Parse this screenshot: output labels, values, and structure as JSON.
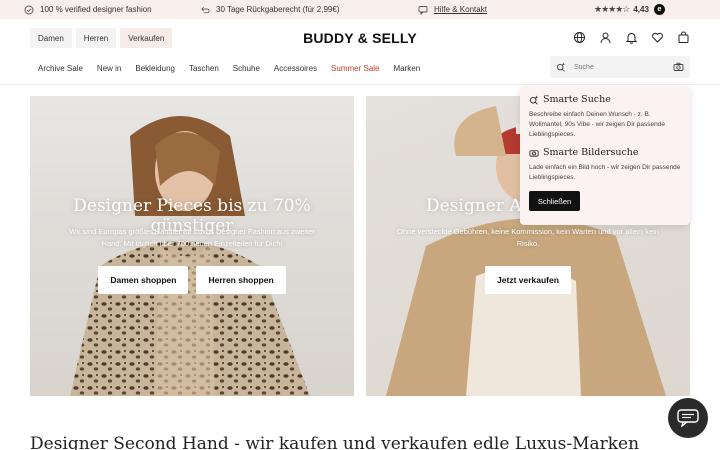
{
  "topbar": {
    "verified": "100 % verified designer fashion",
    "returns": "30 Tage Rückgaberecht (für 2,99€)",
    "help": "Hilfe & Kontakt",
    "stars": "★★★★☆",
    "rating": "4,43",
    "rating_badge": "e"
  },
  "header": {
    "tabs": [
      "Damen",
      "Herren",
      "Verkaufen"
    ],
    "logo": "BUDDY & SELLY",
    "icons": [
      "globe-icon",
      "user-icon",
      "bell-icon",
      "heart-icon",
      "bag-icon"
    ]
  },
  "nav": {
    "items": [
      "Archive Sale",
      "New in",
      "Bekleidung",
      "Taschen",
      "Schuhe",
      "Accessoires",
      "Summer Sale",
      "Marken"
    ],
    "sale_color": "#c0392b"
  },
  "search": {
    "placeholder": "Suche"
  },
  "hero_left": {
    "title": "Designer Pieces bis zu 70% günstiger",
    "subtitle": "Wir sind Europas größter Händler für Luxus Designer Fashion aus zweiter Hand. Mit täglich über 700 neuen Einzelteilen für Dich!",
    "button_women": "Damen shoppen",
    "button_men": "Herren shoppen"
  },
  "hero_right": {
    "title": "Designer Ar",
    "subtitle": "Ohne versteckte Gebühren, keine Kommission, kein Warten und vor allem kein Risiko.",
    "button": "Jetzt verkaufen"
  },
  "popup": {
    "title1": "Smarte Suche",
    "text1": "Beschreibe einfach Deinen Wunsch - z. B. Wollmantel, 90s Vibe - wir zeigen Dir passende Lieblingspieces.",
    "title2": "Smarte Bildersuche",
    "text2": "Lade einfach ein Bild hoch - wir zeigen Dir passende Lieblingspieces.",
    "close": "Schließen"
  },
  "bottom": {
    "heading": "Designer Second Hand - wir kaufen und verkaufen edle Luxus-Marken"
  }
}
